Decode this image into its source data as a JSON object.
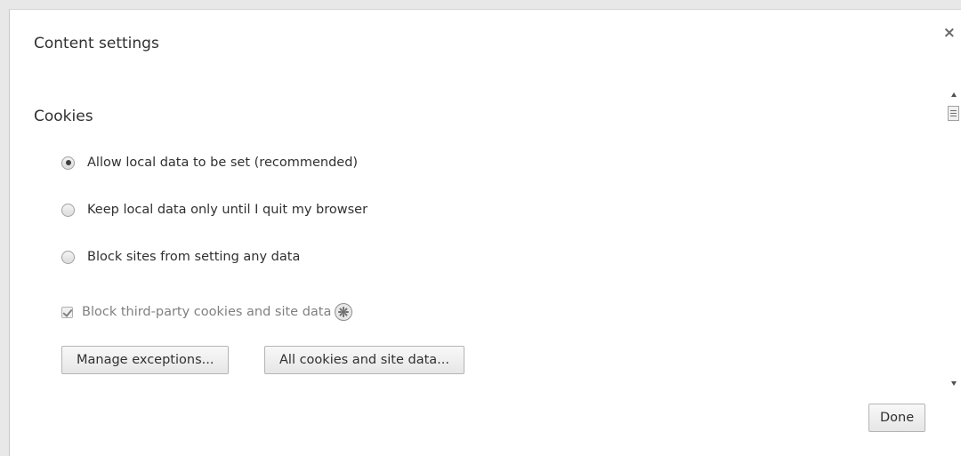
{
  "dialog": {
    "title": "Content settings",
    "close_glyph": "×",
    "done_label": "Done"
  },
  "cookies": {
    "section_title": "Cookies",
    "options": [
      {
        "label": "Allow local data to be set (recommended)",
        "checked": true
      },
      {
        "label": "Keep local data only until I quit my browser",
        "checked": false
      },
      {
        "label": "Block sites from setting any data",
        "checked": false
      }
    ],
    "third_party": {
      "label": "Block third-party cookies and site data",
      "checked": true,
      "disabled": true,
      "icon": "enterprise-policy-icon"
    },
    "manage_exceptions_label": "Manage exceptions...",
    "all_cookies_label": "All cookies and site data..."
  },
  "colors": {
    "text": "#303030",
    "disabled_text": "#808080",
    "button_border": "#b4b4b4"
  }
}
